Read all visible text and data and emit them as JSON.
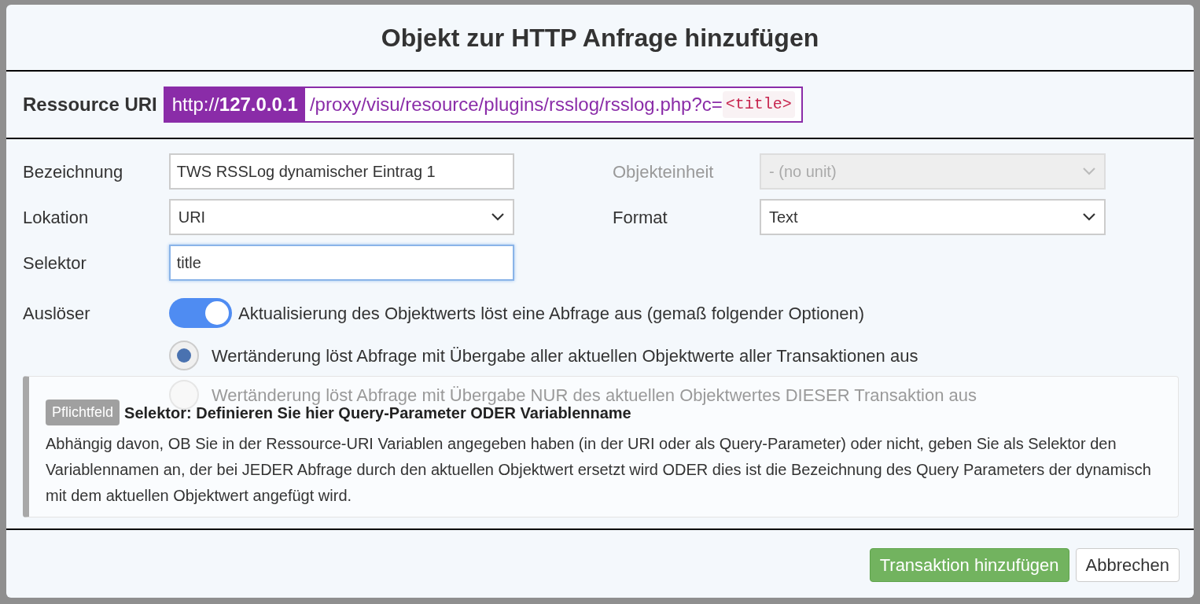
{
  "dialog": {
    "title": "Objekt zur HTTP Anfrage hinzufügen"
  },
  "resource_uri": {
    "label": "Ressource URI",
    "host": "http://**127.0.0.1**",
    "path": "/proxy/visu/resource/plugins/rsslog/rsslog.php?c=",
    "variable": "<title>"
  },
  "form": {
    "left": [
      {
        "kind": "text",
        "label": "Bezeichnung",
        "value": "TWS RSSLog dynamischer Eintrag 1",
        "focused": false
      },
      {
        "kind": "select",
        "label": "Lokation",
        "value": "URI",
        "disabled": false
      },
      {
        "kind": "text",
        "label": "Selektor",
        "value": "title",
        "focused": true
      }
    ],
    "right": [
      {
        "kind": "select",
        "label": "Objekteinheit",
        "value": "- (no unit)",
        "disabled": true
      },
      {
        "kind": "select",
        "label": "Format",
        "value": "Text",
        "disabled": false
      }
    ]
  },
  "trigger": {
    "label": "Auslöser",
    "toggle": {
      "on": true,
      "label": "Aktualisierung des Objektwerts löst eine Abfrage aus (gemaß folgender Optionen)"
    },
    "options": [
      {
        "label": "Wertänderung löst Abfrage mit Übergabe aller aktuellen Objektwerte aller Transaktionen aus",
        "selected": true
      },
      {
        "label": "Wertänderung löst Abfrage mit Übergabe NUR des aktuellen Objektwertes DIESER Transaktion aus",
        "selected": false
      }
    ]
  },
  "help": {
    "badge": "Pflichtfeld",
    "title": "Selektor: Definieren Sie hier Query-Parameter ODER Variablenname",
    "text": "Abhängig davon, OB Sie in der Ressource-URI Variablen angegeben haben (in der URI oder als Query-Parameter) oder nicht, geben Sie als Selektor den Variablennamen an, der bei JEDER Abfrage durch den aktuellen Objektwert ersetzt wird ODER dies ist die Bezeichnung des Query Parameters der dynamisch mit dem aktuellen Objektwert angefügt wird."
  },
  "buttons": [
    {
      "kind": "primary",
      "label": "Transaktion hinzufügen"
    },
    {
      "kind": "default",
      "label": "Abbrechen"
    }
  ]
}
